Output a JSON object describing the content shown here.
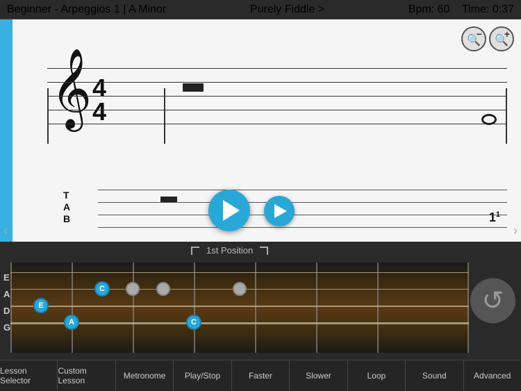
{
  "topbar": {
    "title": "Beginner - Arpeggios 1  |  A Minor",
    "center": "Purely Fiddle >",
    "bpm": "Bpm: 60",
    "time": "Time: 0:37"
  },
  "position_label": "1st Position",
  "strings": [
    "E",
    "A",
    "D",
    "G"
  ],
  "toolbar": {
    "buttons": [
      "Lesson Selector",
      "Custom Lesson",
      "Metronome",
      "Play/Stop",
      "Faster",
      "Slower",
      "Loop",
      "Sound",
      "Advanced"
    ]
  },
  "zoom": {
    "minus": "−",
    "plus": "+"
  },
  "scroll_left": "‹",
  "scroll_right": "›"
}
